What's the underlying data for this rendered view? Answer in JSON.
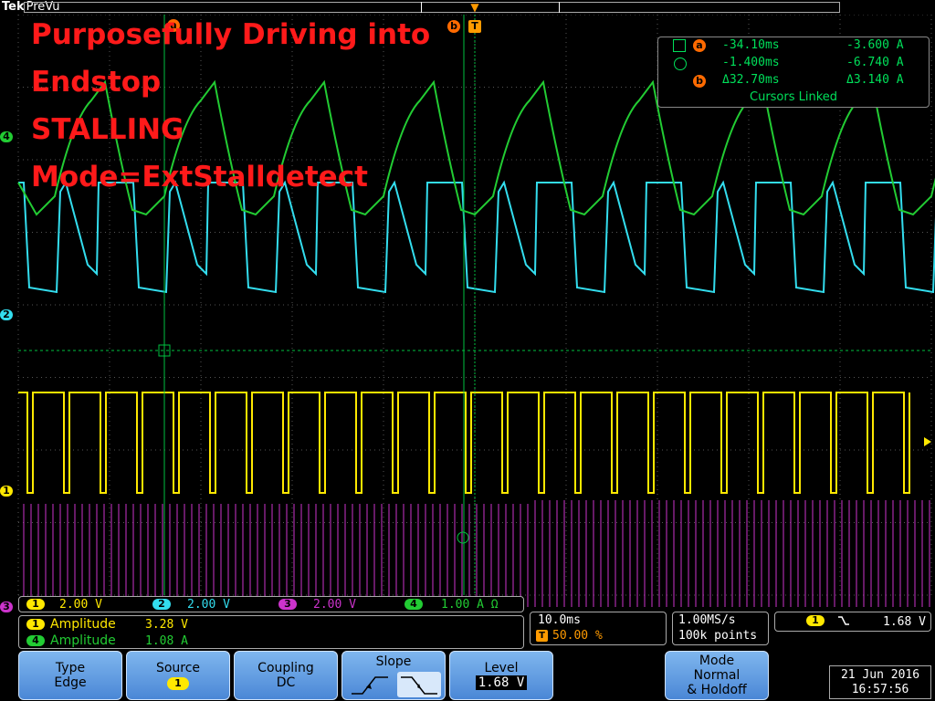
{
  "brand": "Tek",
  "acq_state": "PreVu",
  "overlay_lines": [
    "Purposefully Driving into",
    "Endstop",
    "STALLING",
    "Mode=ExtStalldetect"
  ],
  "cursor_labels": {
    "a": "a",
    "b": "b",
    "trigger": "T"
  },
  "cursor_readout": {
    "a_time": "-34.10ms",
    "a_value": "-3.600 A",
    "b_time": "-1.400ms",
    "b_value": "-6.740 A",
    "delta_time": "Δ32.70ms",
    "delta_value": "Δ3.140 A",
    "linked": "Cursors Linked"
  },
  "channel_markers": {
    "ch4": "4",
    "ch2": "2",
    "ch1": "1",
    "ch3": "3"
  },
  "channels": [
    {
      "id": "1",
      "scale": "2.00 V",
      "color": "#ffe800"
    },
    {
      "id": "2",
      "scale": "2.00 V",
      "color": "#33ddee"
    },
    {
      "id": "3",
      "scale": "2.00 V",
      "color": "#cc33cc"
    },
    {
      "id": "4",
      "scale": "1.00 A  Ω",
      "color": "#22cc33"
    }
  ],
  "measurements": [
    {
      "ch": "1",
      "name": "Amplitude",
      "value": "3.28 V"
    },
    {
      "ch": "4",
      "name": "Amplitude",
      "value": "1.08 A"
    }
  ],
  "timebase": {
    "scale": "10.0ms",
    "trigger_pos": "50.00 %"
  },
  "acquisition": {
    "rate": "1.00MS/s",
    "points": "100k points"
  },
  "trigger": {
    "source": "1",
    "slope_icon": "falling-edge",
    "level": "1.68 V"
  },
  "menu": {
    "type": {
      "label": "Type",
      "value": "Edge"
    },
    "source": {
      "label": "Source",
      "value": "1"
    },
    "coupling": {
      "label": "Coupling",
      "value": "DC"
    },
    "slope": {
      "label": "Slope"
    },
    "level": {
      "label": "Level",
      "value": "1.68 V"
    },
    "mode": {
      "label": "Mode",
      "value1": "Normal",
      "value2": "& Holdoff"
    }
  },
  "datetime": {
    "date": "21 Jun 2016",
    "time": "16:57:56"
  },
  "colors": {
    "ch1": "#ffe800",
    "ch2": "#33ddee",
    "ch3": "#cc33cc",
    "ch4": "#22cc33",
    "overlay": "#ff1a1a",
    "cursor": "#00e05a",
    "accent": "#ff6a00"
  }
}
